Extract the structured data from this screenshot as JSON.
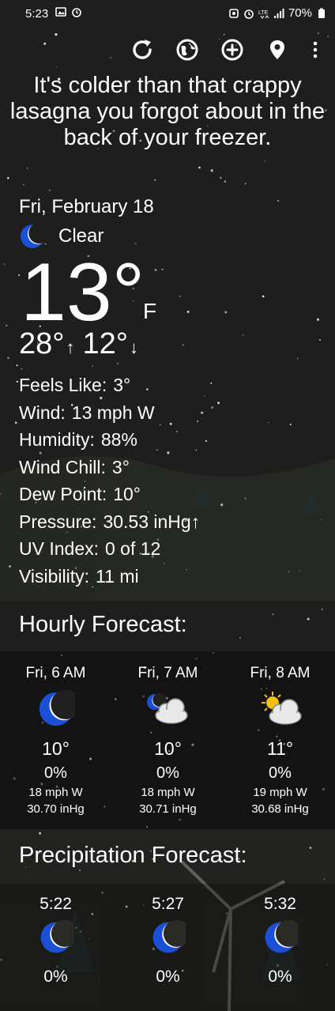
{
  "status_bar": {
    "time": "5:23",
    "battery": "70%"
  },
  "headline": "It's colder than that crappy lasagna you forgot about in the back of your freezer.",
  "current": {
    "date": "Fri, February 18",
    "condition": "Clear",
    "condition_icon": "moon-icon",
    "temperature": "13°",
    "unit": "F",
    "high": "28°",
    "low": "12°",
    "high_arrow": "↑",
    "low_arrow": "↓"
  },
  "details": [
    {
      "label": "Feels Like:",
      "value": "3°"
    },
    {
      "label": "Wind:",
      "value": "13 mph W"
    },
    {
      "label": "Humidity:",
      "value": "88%"
    },
    {
      "label": "Wind Chill:",
      "value": "3°"
    },
    {
      "label": "Dew Point:",
      "value": "10°"
    },
    {
      "label": "Pressure:",
      "value": "30.53 inHg↑"
    },
    {
      "label": "UV Index:",
      "value": "0 of 12"
    },
    {
      "label": "Visibility:",
      "value": "11 mi"
    }
  ],
  "hourly_title": "Hourly Forecast:",
  "hourly": [
    {
      "time": "Fri, 6 AM",
      "icon": "moon-icon",
      "temp": "10°",
      "precip": "0%",
      "wind": "18 mph W",
      "pressure": "30.70 inHg"
    },
    {
      "time": "Fri, 7 AM",
      "icon": "moon-cloud-icon",
      "temp": "10°",
      "precip": "0%",
      "wind": "18 mph W",
      "pressure": "30.71 inHg"
    },
    {
      "time": "Fri, 8 AM",
      "icon": "sun-cloud-icon",
      "temp": "11°",
      "precip": "0%",
      "wind": "19 mph W",
      "pressure": "30.68 inHg"
    }
  ],
  "precip_title": "Precipitation Forecast:",
  "precip": [
    {
      "time": "5:22",
      "icon": "moon-icon",
      "precip": "0%"
    },
    {
      "time": "5:27",
      "icon": "moon-icon",
      "precip": "0%"
    },
    {
      "time": "5:32",
      "icon": "moon-icon",
      "precip": "0%"
    }
  ],
  "colors": {
    "background": "#202020",
    "moon": "#1a4fd6",
    "cloud": "#e8e8e8",
    "sun": "#f4c20d"
  }
}
